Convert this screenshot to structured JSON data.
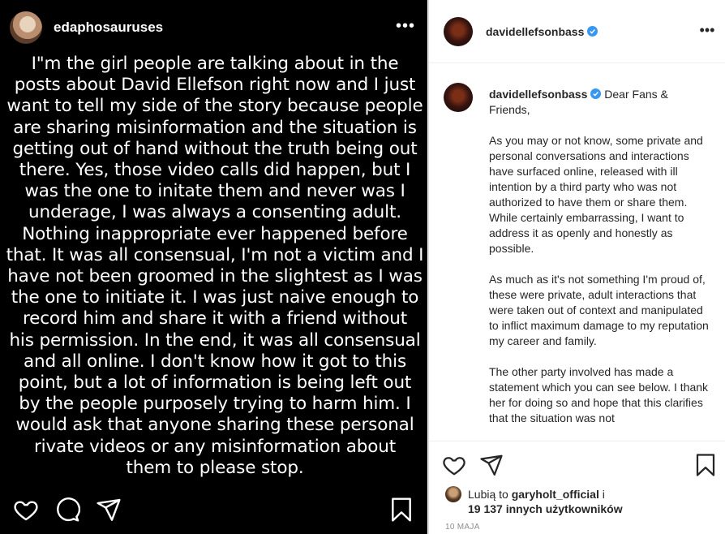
{
  "left_post": {
    "username": "edaphosauruses",
    "more_label": "•••",
    "text_lines": [
      "I\"m the girl people are talking about in the",
      "posts about David Ellefson right now and I just",
      "want to tell my side of the story because people",
      "are sharing misinformation and the situation is",
      "getting out of hand without the truth being out",
      "there. Yes, those video calls did happen, but I",
      "was the one to initate them and never was I",
      "underage, I was always a consenting adult.",
      "Nothing inappropriate ever happened before",
      "that. It was all consensual, I'm not a victim and I",
      "have not been groomed in the slightest as I was",
      "the one to initiate it. I was just naive enough to",
      "record him and share it with a friend without",
      "his permission. In the end, it was all consensual",
      "and all online. I don't know how it got to this",
      "point, but a lot of information is being left out",
      "by the people purposely trying to harm him. I",
      "would ask that anyone sharing these personal",
      "rivate videos or any misinformation about",
      "them to please stop."
    ]
  },
  "right_post": {
    "username": "davidellefsonbass",
    "more_label": "•••",
    "caption": {
      "username": "davidellefsonbass",
      "intro": " Dear Fans & Friends,",
      "paragraphs": [
        "As you may or not know, some private and personal conversations and interactions have surfaced online, released with ill intention by a third party who was not authorized to have them or share them. While certainly embarrassing, I want to address it as openly and honestly as possible.",
        "As much as it's not something I'm proud of, these were private, adult interactions that were taken out of context and manipulated to inflict maximum damage to my reputation my career and family.",
        "The other party involved has made a statement which you can see below. I thank her for doing so and hope that this clarifies that the situation was not"
      ]
    },
    "likes": {
      "prefix": "Lubią to ",
      "user": "garyholt_official",
      "mid": " i",
      "count": "19 137 innych użytkowników"
    },
    "date": "10 MAJA"
  },
  "colors": {
    "verified": "#3897f0",
    "text": "#262626",
    "muted": "#8e8e8e",
    "dark_bg": "#000000"
  }
}
